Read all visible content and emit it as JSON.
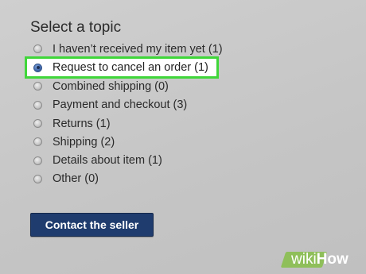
{
  "form": {
    "heading": "Select a topic",
    "topics": [
      {
        "label": "I haven’t received my item yet (1)",
        "selected": false
      },
      {
        "label": "Request to cancel an order (1)",
        "selected": true
      },
      {
        "label": "Combined shipping (0)",
        "selected": false
      },
      {
        "label": "Payment and checkout (3)",
        "selected": false
      },
      {
        "label": "Returns (1)",
        "selected": false
      },
      {
        "label": "Shipping (2)",
        "selected": false
      },
      {
        "label": "Details about item (1)",
        "selected": false
      },
      {
        "label": "Other (0)",
        "selected": false
      }
    ],
    "contact_button": "Contact the seller"
  },
  "watermark": {
    "wiki": "wiki",
    "how": "How"
  },
  "colors": {
    "background": "#c6c6c6",
    "highlight_border": "#40d63a",
    "button_bg": "#1f3c6e",
    "button_text": "#ffffff"
  }
}
